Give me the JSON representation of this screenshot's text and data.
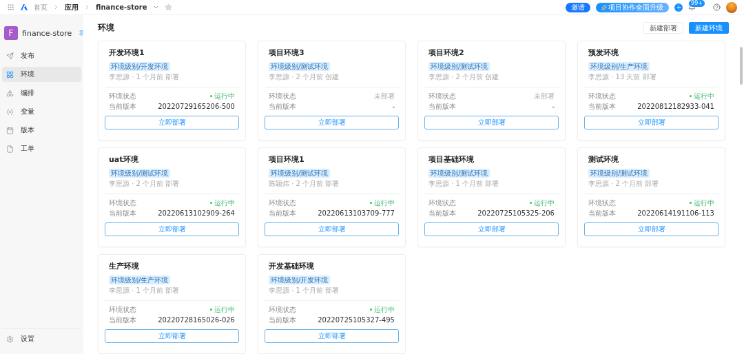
{
  "topbar": {
    "breadcrumb": [
      {
        "label": "首页"
      },
      {
        "label": "应用"
      },
      {
        "label": "finance-store"
      }
    ],
    "invite": "邀请",
    "upgrade": "项目协作全面升级",
    "notification_count": "99+"
  },
  "sidebar": {
    "app_initial": "F",
    "app_name": "finance-store",
    "items": [
      {
        "label": "发布",
        "selected": false
      },
      {
        "label": "环境",
        "selected": true
      },
      {
        "label": "编排",
        "selected": false
      },
      {
        "label": "变量",
        "selected": false
      },
      {
        "label": "版本",
        "selected": false
      },
      {
        "label": "工单",
        "selected": false
      }
    ],
    "settings": "设置"
  },
  "page": {
    "title": "环境",
    "buttons": [
      {
        "label": "新建部署",
        "kind": "secondary"
      },
      {
        "label": "新建环境",
        "kind": "primary"
      }
    ]
  },
  "environments": [
    {
      "name": "开发环境1",
      "tag": "环境级别/开发环境",
      "meta": "李思源 · 1 个月前 部署",
      "status_label": "环境状态",
      "status": "运行中",
      "running": true,
      "version_label": "当前版本",
      "version": "20220729165206-500",
      "action": "立即部署"
    },
    {
      "name": "项目环境3",
      "tag": "环境级别/测试环境",
      "meta": "李思源 · 2 个月前 创建",
      "status_label": "环境状态",
      "status": "未部署",
      "running": false,
      "version_label": "当前版本",
      "version": "-",
      "action": "立即部署"
    },
    {
      "name": "项目环境2",
      "tag": "环境级别/测试环境",
      "meta": "李思源 · 2 个月前 创建",
      "status_label": "环境状态",
      "status": "未部署",
      "running": false,
      "version_label": "当前版本",
      "version": "-",
      "action": "立即部署"
    },
    {
      "name": "预发环境",
      "tag": "环境级别/生产环境",
      "meta": "李思源 · 13 天前 部署",
      "status_label": "环境状态",
      "status": "运行中",
      "running": true,
      "version_label": "当前版本",
      "version": "20220812182933-041",
      "action": "立即部署"
    },
    {
      "name": "uat环境",
      "tag": "环境级别/测试环境",
      "meta": "李思源 · 2 个月前 部署",
      "status_label": "环境状态",
      "status": "运行中",
      "running": true,
      "version_label": "当前版本",
      "version": "20220613102909-264",
      "action": "立即部署"
    },
    {
      "name": "项目环境1",
      "tag": "环境级别/测试环境",
      "meta": "陈颖炜 · 2 个月前 部署",
      "status_label": "环境状态",
      "status": "运行中",
      "running": true,
      "version_label": "当前版本",
      "version": "20220613103709-777",
      "action": "立即部署"
    },
    {
      "name": "项目基础环境",
      "tag": "环境级别/测试环境",
      "meta": "李思源 · 1 个月前 部署",
      "status_label": "环境状态",
      "status": "运行中",
      "running": true,
      "version_label": "当前版本",
      "version": "20220725105325-206",
      "action": "立即部署"
    },
    {
      "name": "测试环境",
      "tag": "环境级别/测试环境",
      "meta": "李思源 · 2 个月前 部署",
      "status_label": "环境状态",
      "status": "运行中",
      "running": true,
      "version_label": "当前版本",
      "version": "20220614191106-113",
      "action": "立即部署"
    },
    {
      "name": "生产环境",
      "tag": "环境级别/生产环境",
      "meta": "李思源 · 1 个月前 部署",
      "status_label": "环境状态",
      "status": "运行中",
      "running": true,
      "version_label": "当前版本",
      "version": "20220728165026-026",
      "action": "立即部署"
    },
    {
      "name": "开发基础环境",
      "tag": "环境级别/开发环境",
      "meta": "李思源 · 1 个月前 部署",
      "status_label": "环境状态",
      "status": "运行中",
      "running": true,
      "version_label": "当前版本",
      "version": "20220725105327-495",
      "action": "立即部署"
    }
  ]
}
